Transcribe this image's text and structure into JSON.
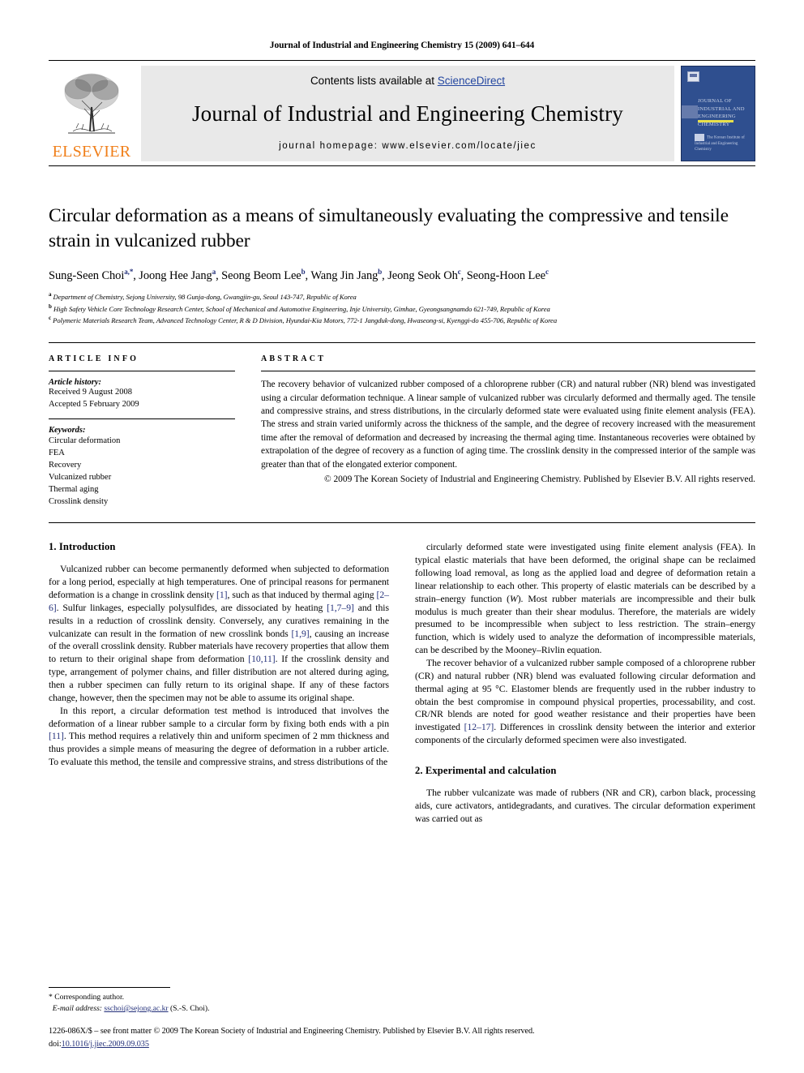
{
  "running_head": "Journal of Industrial and Engineering Chemistry 15 (2009) 641–644",
  "masthead": {
    "publisher_name": "ELSEVIER",
    "contents_prefix": "Contents lists available at ",
    "contents_link": "ScienceDirect",
    "journal_title": "Journal of Industrial and Engineering Chemistry",
    "homepage": "journal homepage: www.elsevier.com/locate/jiec",
    "cover_title": "JOURNAL OF INDUSTRIAL AND ENGINEERING CHEMISTRY",
    "cover_footer": "The Korean Institute of Industrial and Engineering Chemistry",
    "link_color": "#2346a0",
    "elsevier_orange": "#f07f1a",
    "banner_bg": "#e9e9e9",
    "cover_bg": "#2f4f8f"
  },
  "article": {
    "title": "Circular deformation as a means of simultaneously evaluating the compressive and tensile strain in vulcanized rubber",
    "authors": [
      {
        "name": "Sung-Seen Choi",
        "marks": "a,*"
      },
      {
        "name": "Joong Hee Jang",
        "marks": "a"
      },
      {
        "name": "Seong Beom Lee",
        "marks": "b"
      },
      {
        "name": "Wang Jin Jang",
        "marks": "b"
      },
      {
        "name": "Jeong Seok Oh",
        "marks": "c"
      },
      {
        "name": "Seong-Hoon Lee",
        "marks": "c"
      }
    ],
    "affiliations": [
      {
        "mark": "a",
        "text": "Department of Chemistry, Sejong University, 98 Gunja-dong, Gwangjin-gu, Seoul 143-747, Republic of Korea"
      },
      {
        "mark": "b",
        "text": "High Safety Vehicle Core Technology Research Center, School of Mechanical and Automotive Engineering, Inje University, Gimhae, Gyeongsangnamdo 621-749, Republic of Korea"
      },
      {
        "mark": "c",
        "text": "Polymeric Materials Research Team, Advanced Technology Center, R & D Division, Hyundai-Kia Motors, 772-1 Jangduk-dong, Hwaseong-si, Kyenggi-do 455-706, Republic of Korea"
      }
    ]
  },
  "article_info": {
    "label": "ARTICLE INFO",
    "history_label": "Article history:",
    "history_lines": [
      "Received 9 August 2008",
      "Accepted 5 February 2009"
    ],
    "keywords_label": "Keywords:",
    "keywords": [
      "Circular deformation",
      "FEA",
      "Recovery",
      "Vulcanized rubber",
      "Thermal aging",
      "Crosslink density"
    ]
  },
  "abstract": {
    "label": "ABSTRACT",
    "text": "The recovery behavior of vulcanized rubber composed of a chloroprene rubber (CR) and natural rubber (NR) blend was investigated using a circular deformation technique. A linear sample of vulcanized rubber was circularly deformed and thermally aged. The tensile and compressive strains, and stress distributions, in the circularly deformed state were evaluated using finite element analysis (FEA). The stress and strain varied uniformly across the thickness of the sample, and the degree of recovery increased with the measurement time after the removal of deformation and decreased by increasing the thermal aging time. Instantaneous recoveries were obtained by extrapolation of the degree of recovery as a function of aging time. The crosslink density in the compressed interior of the sample was greater than that of the elongated exterior component.",
    "copyright": "© 2009 The Korean Society of Industrial and Engineering Chemistry. Published by Elsevier B.V. All rights reserved."
  },
  "body": {
    "intro_heading": "1. Introduction",
    "experimental_heading": "2. Experimental and calculation",
    "left_paragraphs": [
      {
        "id": "p1",
        "runs": [
          {
            "t": "Vulcanized rubber can become permanently deformed when subjected to deformation for a long period, especially at high temperatures. One of principal reasons for permanent deformation is a change in crosslink density "
          },
          {
            "t": "[1]",
            "cite": true
          },
          {
            "t": ", such as that induced by thermal aging "
          },
          {
            "t": "[2–6]",
            "cite": true
          },
          {
            "t": ". Sulfur linkages, especially polysulfides, are dissociated by heating "
          },
          {
            "t": "[1,7–9]",
            "cite": true
          },
          {
            "t": " and this results in a reduction of crosslink density. Conversely, any curatives remaining in the vulcanizate can result in the formation of new crosslink bonds "
          },
          {
            "t": "[1,9]",
            "cite": true
          },
          {
            "t": ", causing an increase of the overall crosslink density. Rubber materials have recovery properties that allow them to return to their original shape from deformation "
          },
          {
            "t": "[10,11]",
            "cite": true
          },
          {
            "t": ". If the crosslink density and type, arrangement of polymer chains, and filler distribution are not altered during aging, then a rubber specimen can fully return to its original shape. If any of these factors change, however, then the specimen may not be able to assume its original shape."
          }
        ]
      },
      {
        "id": "p2",
        "runs": [
          {
            "t": "In this report, a circular deformation test method is introduced that involves the deformation of a linear rubber sample to a circular form by fixing both ends with a pin "
          },
          {
            "t": "[11]",
            "cite": true
          },
          {
            "t": ". This method requires a relatively thin and uniform specimen of 2 mm thickness and thus provides a simple means of measuring the degree of deformation in a rubber article. To evaluate this method, the tensile and compressive strains, and stress distributions of the"
          }
        ]
      }
    ],
    "right_paragraphs": [
      {
        "id": "p3",
        "runs": [
          {
            "t": "circularly deformed state were investigated using finite element analysis (FEA). In typical elastic materials that have been deformed, the original shape can be reclaimed following load removal, as long as the applied load and degree of deformation retain a linear relationship to each other. This property of elastic materials can be described by a strain–energy function ("
          },
          {
            "t": "W",
            "italic": true
          },
          {
            "t": "). Most rubber materials are incompressible and their bulk modulus is much greater than their shear modulus. Therefore, the materials are widely presumed to be incompressible when subject to less restriction. The strain–energy function, which is widely used to analyze the deformation of incompressible materials, can be described by the Mooney–Rivlin equation."
          }
        ],
        "no_indent": false
      },
      {
        "id": "p4",
        "runs": [
          {
            "t": "The recover behavior of a vulcanized rubber sample composed of a chloroprene rubber (CR) and natural rubber (NR) blend was evaluated following circular deformation and thermal aging at 95 °C. Elastomer blends are frequently used in the rubber industry to obtain the best compromise in compound physical properties, processability, and cost. CR/NR blends are noted for good weather resistance and their properties have been investigated "
          },
          {
            "t": "[12–17]",
            "cite": true
          },
          {
            "t": ". Differences in crosslink density between the interior and exterior components of the circularly deformed specimen were also investigated."
          }
        ]
      },
      {
        "id": "p5",
        "runs": [
          {
            "t": "The rubber vulcanizate was made of rubbers (NR and CR), carbon black, processing aids, cure activators, antidegradants, and curatives. The circular deformation experiment was carried out as"
          }
        ]
      }
    ]
  },
  "footnotes": {
    "corresponding_mark": "*",
    "corresponding_label": "Corresponding author.",
    "email_label": "E-mail address:",
    "email": "sschoi@sejong.ac.kr",
    "email_owner": "(S.-S. Choi)."
  },
  "footer": {
    "issn_line": "1226-086X/$ – see front matter © 2009 The Korean Society of Industrial and Engineering Chemistry. Published by Elsevier B.V. All rights reserved.",
    "doi_label": "doi:",
    "doi": "10.1016/j.jiec.2009.09.035"
  }
}
